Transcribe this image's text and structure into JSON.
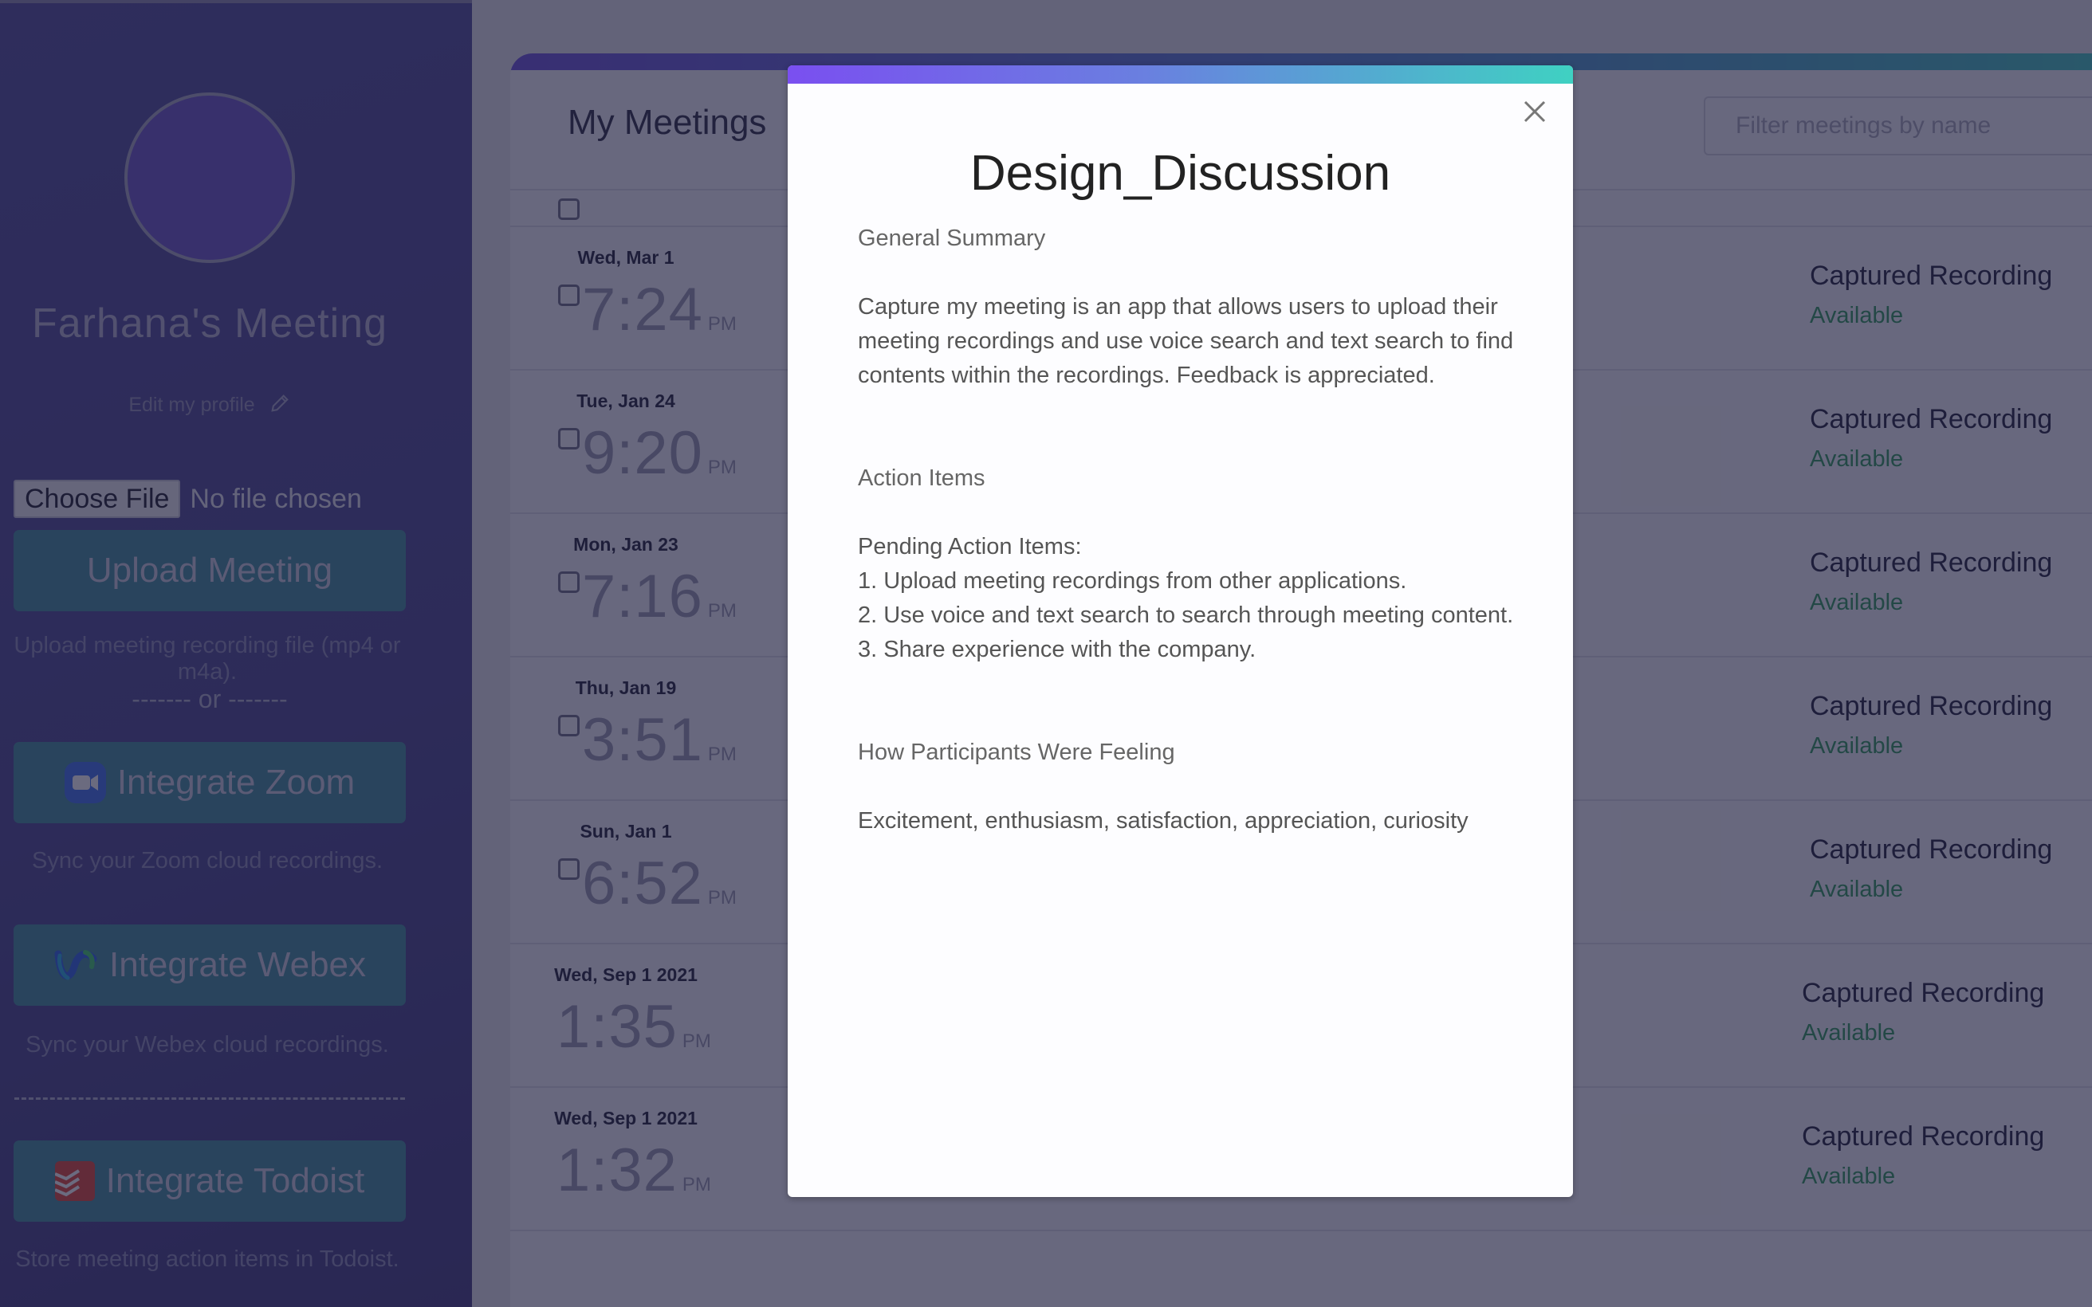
{
  "sidebar": {
    "profile_name": "Farhana's Meeting",
    "edit_profile_label": "Edit my profile",
    "choose_file_label": "Choose File",
    "no_file_label": "No file chosen",
    "upload_button": "Upload Meeting",
    "upload_help": "Upload meeting recording file (mp4 or m4a).",
    "or_separator": "------- or -------",
    "zoom_button": "Integrate Zoom",
    "zoom_help": "Sync your Zoom cloud recordings.",
    "webex_button": "Integrate Webex",
    "webex_help": "Sync your Webex cloud recordings.",
    "todoist_button": "Integrate Todoist",
    "todoist_help": "Store meeting action items in Todoist."
  },
  "main": {
    "title": "My Meetings",
    "filter_placeholder": "Filter meetings by name",
    "meetings": [
      {
        "date": "Wed, Mar 1",
        "time": "7:24",
        "ampm": "PM",
        "status": "Captured Recording",
        "availability": "Available"
      },
      {
        "date": "Tue, Jan 24",
        "time": "9:20",
        "ampm": "PM",
        "status": "Captured Recording",
        "availability": "Available"
      },
      {
        "date": "Mon, Jan 23",
        "time": "7:16",
        "ampm": "PM",
        "status": "Captured Recording",
        "availability": "Available"
      },
      {
        "date": "Thu, Jan 19",
        "time": "3:51",
        "ampm": "PM",
        "status": "Captured Recording",
        "availability": "Available"
      },
      {
        "date": "Sun, Jan 1",
        "time": "6:52",
        "ampm": "PM",
        "status": "Captured Recording",
        "availability": "Available"
      },
      {
        "date": "Wed, Sep 1 2021",
        "time": "1:35",
        "ampm": "PM",
        "status": "Captured Recording",
        "availability": "Available"
      },
      {
        "date": "Wed, Sep 1 2021",
        "time": "1:32",
        "ampm": "PM",
        "status": "Captured Recording",
        "availability": "Available"
      }
    ]
  },
  "modal": {
    "title": "Design_Discussion",
    "general_summary_heading": "General Summary",
    "summary_lines": [
      "Capture my meeting is an app that allows users to upload their",
      "meeting recordings and use voice search and text search to find",
      "contents within the recordings. Feedback is appreciated."
    ],
    "action_items_heading": "Action Items",
    "pending_label": "Pending Action Items:",
    "action_items": [
      "1. Upload meeting recordings from other applications.",
      "2. Use voice and text search to search through meeting content.",
      "3. Share experience with the company."
    ],
    "feeling_heading": "How Participants Were Feeling",
    "feelings": "Excitement, enthusiasm, satisfaction, appreciation, curiosity"
  },
  "colors": {
    "sidebar_bg": "#4f4a9a",
    "button_teal": "#3f8c9c",
    "available_green": "#2e9a5a",
    "accent_purple": "#7a4ff0",
    "accent_teal": "#3fd1c2"
  }
}
